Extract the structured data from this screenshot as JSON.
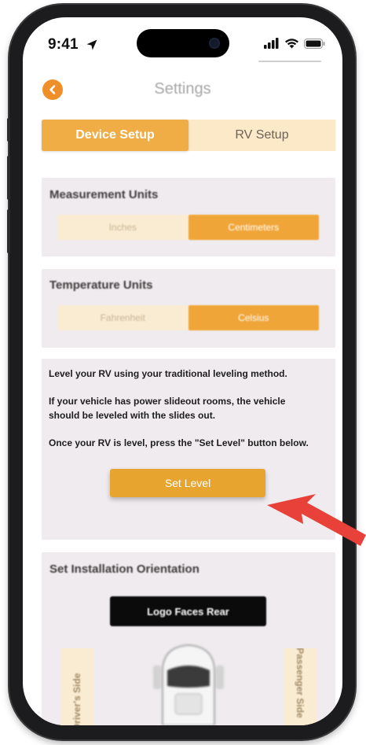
{
  "status_bar": {
    "time": "9:41",
    "location_icon": "location-arrow-icon",
    "signal_icon": "cellular-signal-icon",
    "wifi_icon": "wifi-icon",
    "battery_icon": "battery-icon"
  },
  "header": {
    "back_icon": "chevron-left-icon",
    "title": "Settings"
  },
  "tabs": [
    {
      "label": "Device Setup",
      "active": true
    },
    {
      "label": "RV Setup",
      "active": false
    }
  ],
  "measurement_units": {
    "title": "Measurement Units",
    "options": [
      {
        "label": "Inches",
        "active": false
      },
      {
        "label": "Centimeters",
        "active": true
      }
    ]
  },
  "temperature_units": {
    "title": "Temperature Units",
    "options": [
      {
        "label": "Fahrenheit",
        "active": false
      },
      {
        "label": "Celsius",
        "active": true
      }
    ]
  },
  "leveling": {
    "instructions": [
      "Level your RV using your traditional leveling method.",
      "If your vehicle has power slideout rooms, the vehicle should be leveled with the slides out.",
      "Once your RV is level, press the \"Set Level\" button below."
    ],
    "button_label": "Set Level"
  },
  "installation_orientation": {
    "title": "Set Installation Orientation",
    "orientation_button_label": "Logo Faces Rear",
    "left_side_label": "Driver's Side",
    "right_side_label": "Passenger Side",
    "vehicle_icon": "rv-top-view-icon"
  },
  "annotation": {
    "arrow_icon": "red-pointer-arrow-icon",
    "color": "#e8413a"
  },
  "colors": {
    "accent": "#f0ac45",
    "accent_light": "#fbe9c8",
    "card_bg": "#efebee",
    "back_button": "#ee8f2a"
  }
}
